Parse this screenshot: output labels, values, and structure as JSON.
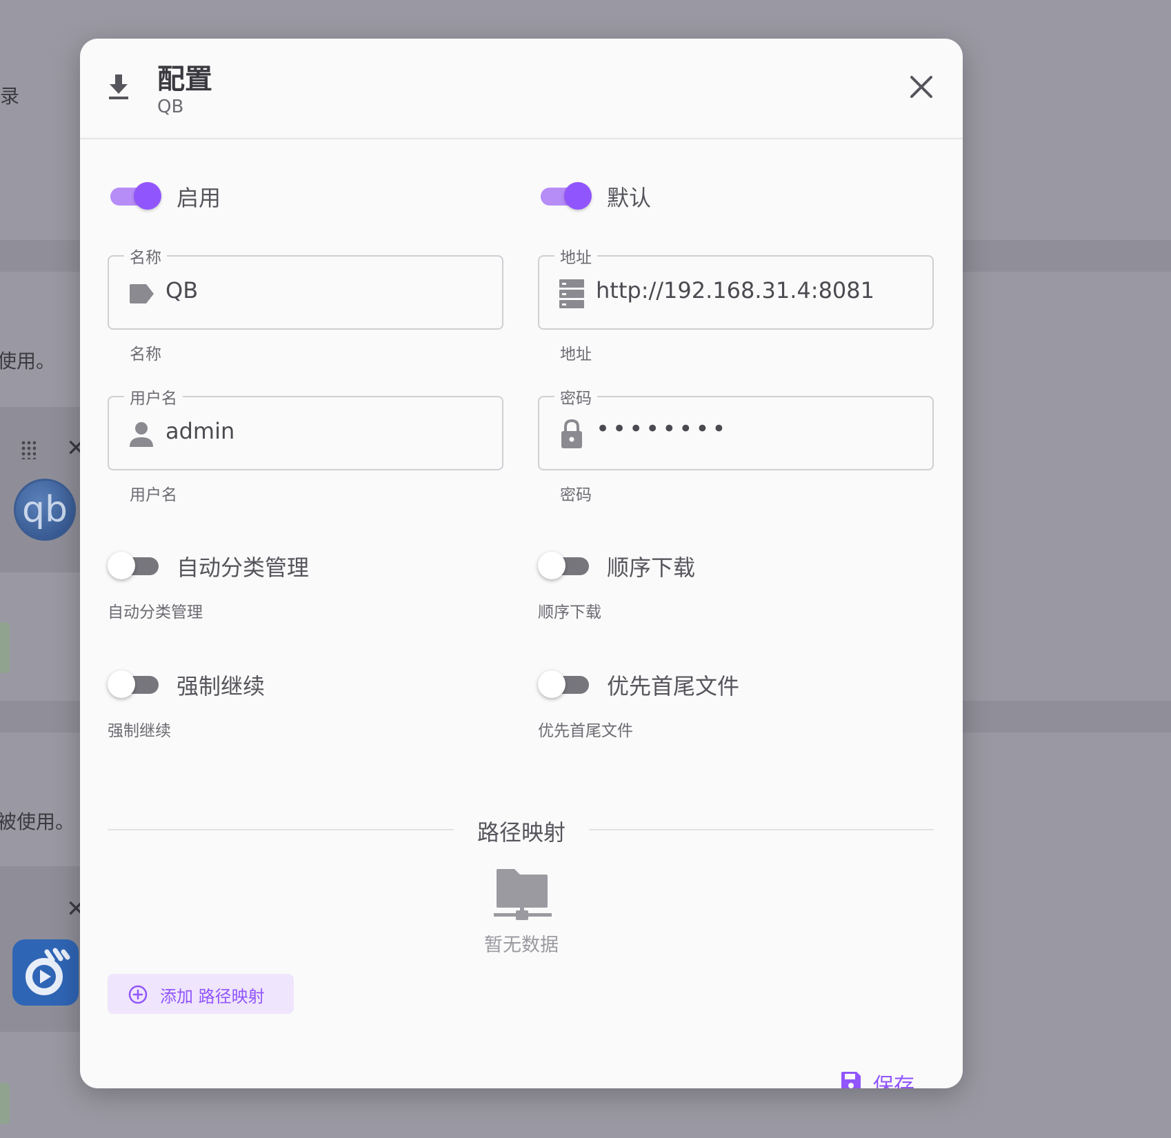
{
  "background": {
    "frag_1": "目录",
    "frag_2": "使用。",
    "frag_3": "被使用。",
    "logo_text": "qb"
  },
  "dialog": {
    "title": "配置",
    "subtitle": "QB",
    "toggles": {
      "enable": {
        "label": "启用",
        "on": true
      },
      "default": {
        "label": "默认",
        "on": true
      },
      "auto_category": {
        "label": "自动分类管理",
        "hint": "自动分类管理",
        "on": false
      },
      "sequential": {
        "label": "顺序下载",
        "hint": "顺序下载",
        "on": false
      },
      "force_resume": {
        "label": "强制继续",
        "hint": "强制继续",
        "on": false
      },
      "first_last": {
        "label": "优先首尾文件",
        "hint": "优先首尾文件",
        "on": false
      }
    },
    "fields": {
      "name": {
        "legend": "名称",
        "value": "QB",
        "hint": "名称",
        "icon": "tag-icon"
      },
      "address": {
        "legend": "地址",
        "value": "http://192.168.31.4:8081",
        "hint": "地址",
        "icon": "server-icon"
      },
      "username": {
        "legend": "用户名",
        "value": "admin",
        "hint": "用户名",
        "icon": "user-icon"
      },
      "password": {
        "legend": "密码",
        "value": "••••••••",
        "hint": "密码",
        "icon": "lock-icon"
      }
    },
    "path_mapping": {
      "heading": "路径映射",
      "empty_text": "暂无数据",
      "add_label": "添加 路径映射"
    },
    "save_label": "保存"
  },
  "colors": {
    "accent": "#9155fd",
    "accent_light": "#b68cf7",
    "overlay": "#9a99a3",
    "dialog_bg": "#fafafa"
  }
}
